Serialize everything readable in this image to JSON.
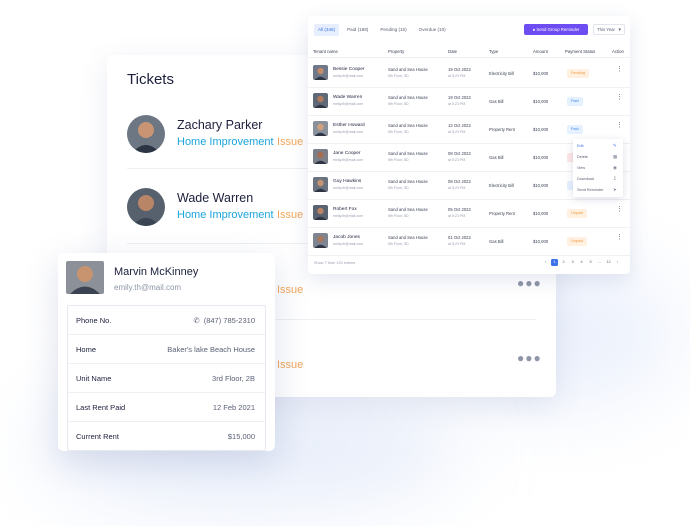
{
  "tickets": {
    "title": "Tickets",
    "items": [
      {
        "name": "Zachary Parker",
        "category": "Home Improvement",
        "status": "Issue"
      },
      {
        "name": "Wade Warren",
        "category": "Home Improvement",
        "status": "Issue"
      },
      {
        "status": "Issue"
      },
      {
        "status": "Issue"
      }
    ]
  },
  "rent_table": {
    "tabs": [
      {
        "label": "All (346)"
      },
      {
        "label": "Paid (188)"
      },
      {
        "label": "Pending (15)"
      },
      {
        "label": "Overdue (10)"
      }
    ],
    "send_button": "Send Group Reminder",
    "year_select": "This Year",
    "headers": [
      "Tenant name",
      "Property",
      "Date",
      "Type",
      "Amount",
      "Payment Status",
      "Action"
    ],
    "rows": [
      {
        "name": "Bessie Cooper",
        "email": "emily.th@mail.com",
        "property": "Sand and Sea House",
        "floor": "5th Floor, 5D",
        "date": "19 Oct 2022",
        "time": "at 5:23 PM",
        "type": "Electricity Bill",
        "amount": "$10,000",
        "status": "Pending",
        "status_kind": "pending"
      },
      {
        "name": "Wade Warren",
        "email": "emily.th@mail.com",
        "property": "Sand and Sea House",
        "floor": "5th Floor, 5D",
        "date": "19 Oct 2022",
        "time": "at 5:23 PM",
        "type": "Gas Bill",
        "amount": "$10,000",
        "status": "Paid",
        "status_kind": "paid"
      },
      {
        "name": "Esther Howard",
        "email": "emily.th@mail.com",
        "property": "Sand and Sea House",
        "floor": "5th Floor, 5D",
        "date": "12 Oct 2022",
        "time": "at 5:23 PM",
        "type": "Property Rent",
        "amount": "$10,000",
        "status": "Paid",
        "status_kind": "paid"
      },
      {
        "name": "Jane Cooper",
        "email": "emily.th@mail.com",
        "property": "Sand and Sea House",
        "floor": "5th Floor, 5D",
        "date": "08 Oct 2022",
        "time": "at 5:23 PM",
        "type": "Gas Bill",
        "amount": "$10,000",
        "status": "",
        "status_kind": "overdue"
      },
      {
        "name": "Guy Hawkins",
        "email": "emily.th@mail.com",
        "property": "Sand and Sea House",
        "floor": "5th Floor, 5D",
        "date": "08 Oct 2022",
        "time": "at 5:23 PM",
        "type": "Electricity Bill",
        "amount": "$10,000",
        "status": "",
        "status_kind": "paid"
      },
      {
        "name": "Robert Fox",
        "email": "emily.th@mail.com",
        "property": "Sand and Sea House",
        "floor": "5th Floor, 5D",
        "date": "05 Oct 2022",
        "time": "at 5:23 PM",
        "type": "Property Rent",
        "amount": "$10,000",
        "status": "Unpaid",
        "status_kind": "pending"
      },
      {
        "name": "Jacob Jones",
        "email": "emily.th@mail.com",
        "property": "Sand and Sea House",
        "floor": "5th Floor, 5D",
        "date": "01 Oct 2022",
        "time": "at 5:23 PM",
        "type": "Gas Bill",
        "amount": "$10,000",
        "status": "Unpaid",
        "status_kind": "pending"
      }
    ],
    "action_menu": [
      "Edit",
      "Delete",
      "View",
      "Download",
      "Send Reminder"
    ],
    "footer_text": "Show 7 from 120 entries",
    "pages": [
      "‹",
      "1",
      "2",
      "3",
      "4",
      "5",
      "...",
      "12",
      "›"
    ]
  },
  "tenant": {
    "name": "Marvin McKinney",
    "email": "emily.th@mail.com",
    "details": [
      {
        "label": "Phone No.",
        "value": "(847) 785-2310"
      },
      {
        "label": "Home",
        "value": "Baker's lake Beach House"
      },
      {
        "label": "Unit Name",
        "value": "3rd Floor, 2B"
      },
      {
        "label": "Last Rent Paid",
        "value": "12 Feb 2021"
      },
      {
        "label": "Current Rent",
        "value": "$15,000"
      }
    ]
  }
}
